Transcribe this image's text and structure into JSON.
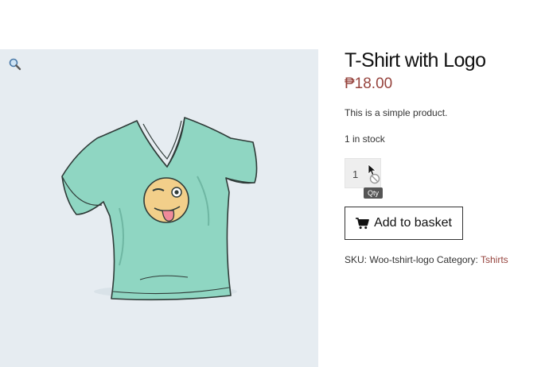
{
  "product": {
    "title": "T-Shirt with Logo",
    "price": "₱18.00",
    "short_description": "This is a simple product.",
    "stock": "1 in stock",
    "quantity": "1",
    "quantity_tooltip": "Qty",
    "add_to_basket_label": "Add to basket",
    "meta": {
      "sku_label": "SKU:",
      "sku_value": "Woo-tshirt-logo",
      "category_label": "Category:",
      "category_value": "Tshirts"
    }
  },
  "gallery": {
    "zoom_icon": "magnifier-icon",
    "background_color": "#e6ecf1"
  },
  "colors": {
    "price": "#96433d",
    "link": "#96433d",
    "shirt": "#8fd6c2"
  }
}
